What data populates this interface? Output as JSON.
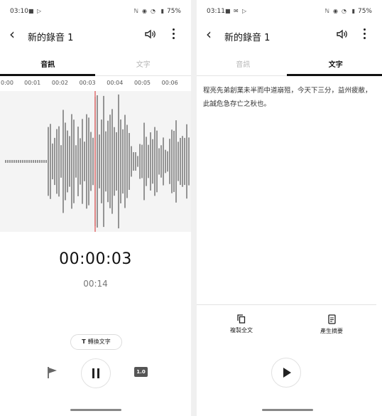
{
  "left": {
    "status": {
      "time": "03:10",
      "battery": "75%"
    },
    "title": "新的錄音 1",
    "tabs": [
      {
        "label": "音訊"
      },
      {
        "label": "文字"
      }
    ],
    "ruler_ticks": [
      "0:00",
      "00:01",
      "00:02",
      "00:03",
      "00:04",
      "00:05",
      "00:06"
    ],
    "elapsed": "00:00:03",
    "total": "00:14",
    "transcribe_button": {
      "icon": "T",
      "label": "轉換文字"
    },
    "speed": "1.0",
    "icons": [
      "back-arrow-icon",
      "speaker-icon",
      "more-vert-icon",
      "flag-icon",
      "pause-icon"
    ]
  },
  "right": {
    "status": {
      "time": "03:11",
      "battery": "75%"
    },
    "title": "新的錄音 1",
    "tabs": [
      {
        "label": "音訊"
      },
      {
        "label": "文字"
      }
    ],
    "transcript": "程亮先弟創業未半而中道崩殂，今天下三分，益州疲敝，此誠危急存亡之秋也。",
    "actions": {
      "copy": "複製全文",
      "summary": "產生摘要"
    },
    "icons": [
      "copy-icon",
      "document-icon",
      "play-icon"
    ]
  },
  "colors": {
    "playhead": "#e05a5a",
    "waveform": "#555555",
    "tab_indicator": "#111111"
  }
}
